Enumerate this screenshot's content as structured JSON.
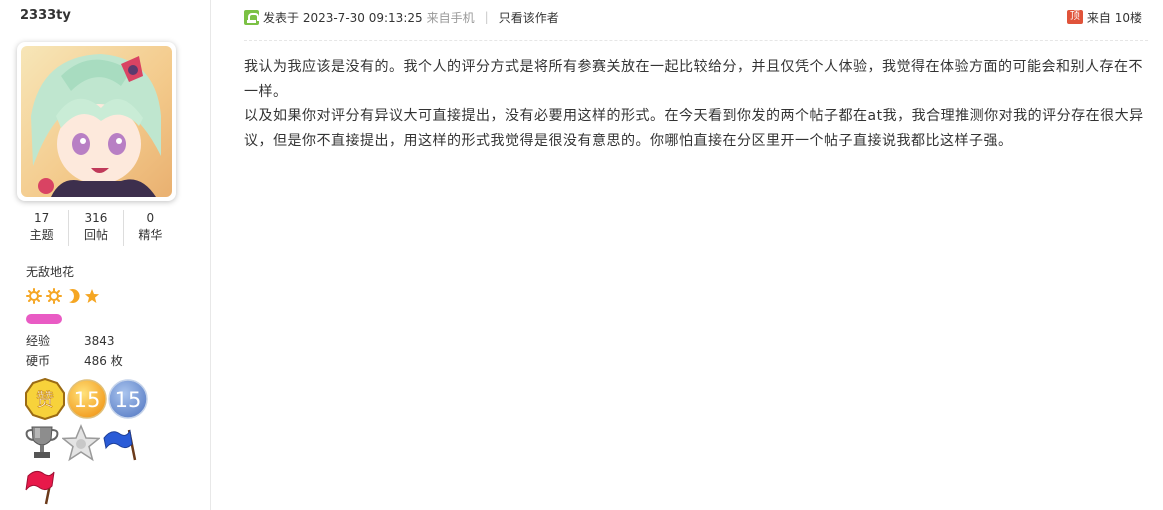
{
  "user": {
    "name": "2333ty",
    "stats": [
      {
        "num": "17",
        "label": "主题"
      },
      {
        "num": "316",
        "label": "回帖"
      },
      {
        "num": "0",
        "label": "精华"
      }
    ],
    "rank_title": "无敌地花",
    "rank_icons": [
      "sun-icon",
      "sun-icon",
      "moon-icon",
      "star-icon"
    ],
    "exp_label": "经验",
    "exp_value": "3843",
    "coin_label": "硬币",
    "coin_value": "486 枚",
    "medals": [
      {
        "name": "zan-medal",
        "text": "赞"
      },
      {
        "name": "gold-15-medal",
        "text": "15"
      },
      {
        "name": "blue-15-medal",
        "text": "15"
      },
      {
        "name": "silver-trophy-medal",
        "text": ""
      },
      {
        "name": "silver-star-medal",
        "text": ""
      },
      {
        "name": "blue-flag-medal",
        "text": ""
      },
      {
        "name": "red-flag-medal",
        "text": ""
      }
    ]
  },
  "post": {
    "posted_label": "发表于 2023-7-30 09:13:25",
    "source": "来自手机",
    "separator": "|",
    "only_author": "只看该作者",
    "floor_badge": "顶",
    "floor": "来自 10楼",
    "paragraphs": [
      "我认为我应该是没有的。我个人的评分方式是将所有参赛关放在一起比较给分，并且仅凭个人体验，我觉得在体验方面的可能会和别人存在不一样。",
      "以及如果你对评分有异议大可直接提出，没有必要用这样的形式。在今天看到你发的两个帖子都在at我，我合理推测你对我的评分存在很大异议，但是你不直接提出，用这样的形式我觉得是很没有意思的。你哪怕直接在分区里开一个帖子直接说我都比这样子强。"
    ]
  },
  "colors": {
    "level_bar": "#e95bc4",
    "floor_badge": "#e0533a",
    "post_icon": "#7bc144",
    "rank_icon": "#f5a623"
  }
}
